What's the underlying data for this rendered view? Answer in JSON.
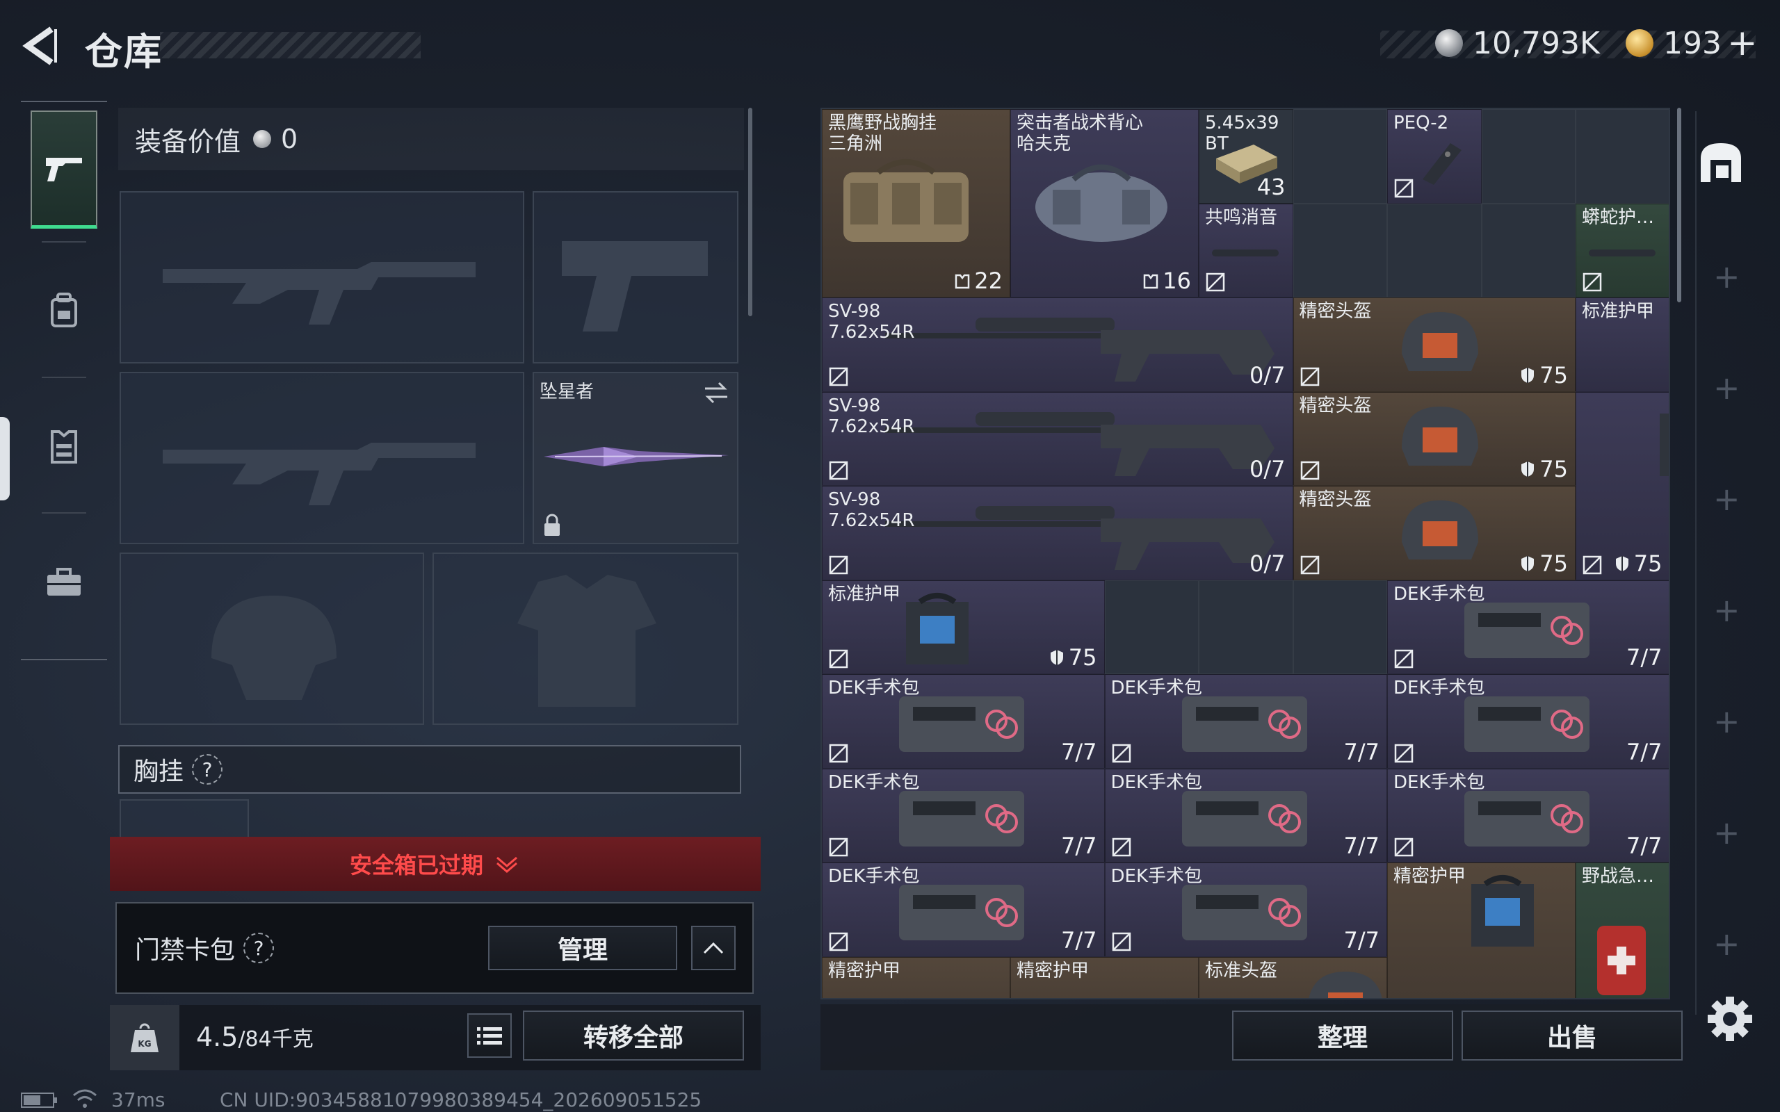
{
  "header": {
    "title": "仓库",
    "currency_1": "10,793K",
    "currency_2": "193",
    "add_label": "+"
  },
  "colors": {
    "accent_green": "#3fdc8f",
    "warning_red": "#ff4b4b",
    "item_brown": "#54473b",
    "item_purple": "#3e3c58",
    "item_green": "#34493e"
  },
  "nav": {
    "items": [
      {
        "name": "gun-icon"
      },
      {
        "name": "backpack-icon"
      },
      {
        "name": "vest-icon"
      },
      {
        "name": "briefcase-icon"
      }
    ]
  },
  "equipment": {
    "value_label": "装备价值",
    "value": "0",
    "melee_name": "坠星者",
    "chest_label": "胸挂",
    "safe_warning": "安全箱已过期",
    "card_label": "门禁卡包",
    "manage_label": "管理",
    "weight_value": "4.5",
    "weight_max": "/84千克",
    "transfer_label": "转移全部"
  },
  "storage": {
    "sort_label": "整理",
    "sell_label": "出售",
    "items": [
      {
        "name": "黑鹰野战胸挂\n三角洲",
        "count": "22"
      },
      {
        "name": "突击者战术背心\n哈夫克",
        "count": "16"
      },
      {
        "name": "5.45x39\nBT",
        "count": "43"
      },
      {
        "name": "PEQ-2",
        "count": ""
      },
      {
        "name": "共鸣消音",
        "count": ""
      },
      {
        "name": "蟒蛇护…",
        "count": ""
      },
      {
        "name": "SV-98\n7.62x54R",
        "count": "0/7"
      },
      {
        "name": "精密头盔",
        "count": "75"
      },
      {
        "name": "标准护甲",
        "count": ""
      },
      {
        "name": "SV-98\n7.62x54R",
        "count": "0/7"
      },
      {
        "name": "精密头盔",
        "count": "75"
      },
      {
        "name": "SV-98\n7.62x54R",
        "count": "0/7"
      },
      {
        "name": "精密头盔",
        "count": "75"
      },
      {
        "name": "",
        "count": "75"
      },
      {
        "name": "标准护甲",
        "count": "75"
      },
      {
        "name": "DEK手术包",
        "count": "7/7"
      },
      {
        "name": "DEK手术包",
        "count": "7/7"
      },
      {
        "name": "DEK手术包",
        "count": "7/7"
      },
      {
        "name": "DEK手术包",
        "count": "7/7"
      },
      {
        "name": "DEK手术包",
        "count": "7/7"
      },
      {
        "name": "DEK手术包",
        "count": "7/7"
      },
      {
        "name": "DEK手术包",
        "count": "7/7"
      },
      {
        "name": "DEK手术包",
        "count": "7/7"
      },
      {
        "name": "DEK手术包",
        "count": "7/7"
      },
      {
        "name": "精密护甲",
        "count": ""
      },
      {
        "name": "野战急…",
        "count": ""
      },
      {
        "name": "精密护甲",
        "count": ""
      },
      {
        "name": "精密护甲",
        "count": ""
      },
      {
        "name": "标准头盔",
        "count": ""
      }
    ]
  },
  "status": {
    "ping": "37ms",
    "uid": "CN UID:9034588107998038945​4_202609051525"
  }
}
